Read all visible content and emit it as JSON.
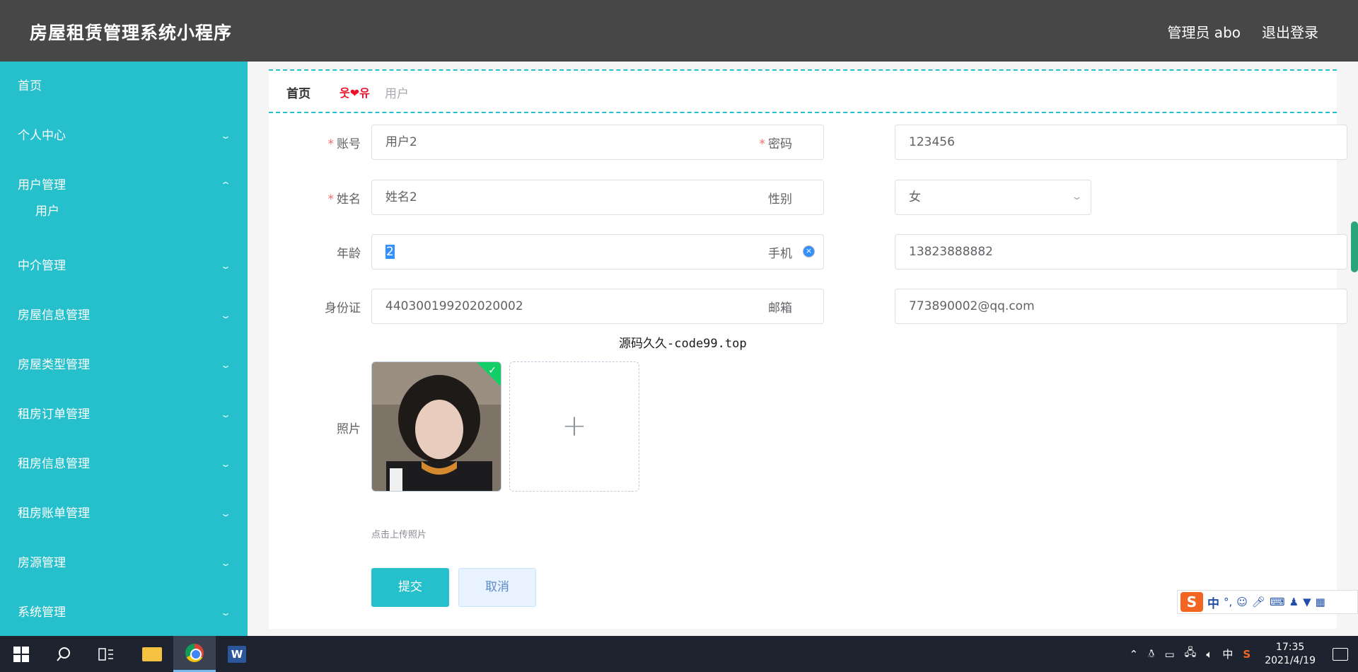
{
  "header": {
    "app_title": "房屋租赁管理系统小程序",
    "user_label": "管理员 abo",
    "logout_label": "退出登录"
  },
  "sidebar": {
    "items": [
      {
        "label": "首页"
      },
      {
        "label": "个人中心"
      },
      {
        "label": "用户管理",
        "expanded": true,
        "sub": [
          {
            "label": "用户"
          }
        ]
      },
      {
        "label": "中介管理"
      },
      {
        "label": "房屋信息管理"
      },
      {
        "label": "房屋类型管理"
      },
      {
        "label": "租房订单管理"
      },
      {
        "label": "租房信息管理"
      },
      {
        "label": "租房账单管理"
      },
      {
        "label": "房源管理"
      },
      {
        "label": "系统管理"
      }
    ]
  },
  "breadcrumb": {
    "home": "首页",
    "separator": "웃❤유",
    "current": "用户"
  },
  "form": {
    "account_label": "账号",
    "account_value": "用户2",
    "password_label": "密码",
    "password_value": "123456",
    "name_label": "姓名",
    "name_value": "姓名2",
    "gender_label": "性别",
    "gender_value": "女",
    "age_label": "年龄",
    "age_value": "2",
    "phone_label": "手机",
    "phone_value": "13823888882",
    "idcard_label": "身份证",
    "idcard_value": "440300199202020002",
    "email_label": "邮箱",
    "email_value": "773890002@qq.com",
    "photo_label": "照片",
    "upload_tip": "点击上传照片",
    "submit_label": "提交",
    "cancel_label": "取消",
    "required_mark": "*"
  },
  "overlay_text": "源码久久-code99.top",
  "ime": {
    "logo": "S",
    "mode": "中"
  },
  "taskbar": {
    "time": "17:35",
    "date": "2021/4/19",
    "ime_indicator": "中"
  },
  "colors": {
    "header_bg": "#474747",
    "sidebar_bg": "#26c0cc",
    "accent": "#26c0cc",
    "required": "#f56c6c"
  }
}
